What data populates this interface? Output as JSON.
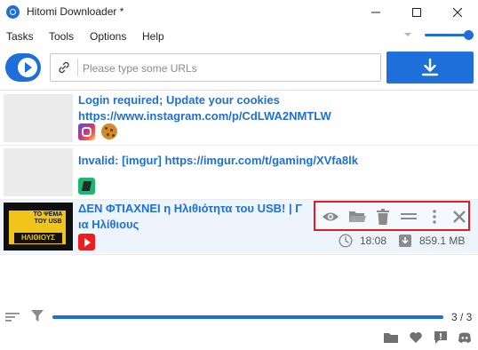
{
  "window": {
    "title": "Hitomi Downloader *"
  },
  "menu": [
    "Tasks",
    "Tools",
    "Options",
    "Help"
  ],
  "toolbar": {
    "url_placeholder": "Please type some URLs",
    "url_value": ""
  },
  "tasks": [
    {
      "title": "Login required; Update your cookies https://www.instagram.com/p/CdLWA2NMTLW",
      "site_icon": "instagram-icon",
      "extra_icon": "cookie-icon",
      "selected": false
    },
    {
      "title": "Invalid: [imgur] https://imgur.com/t/gaming/XVfa8lk",
      "site_icon": "imgur-icon",
      "selected": false
    },
    {
      "title": "ΔΕΝ ΦΤΙΑΧΝΕΙ η Ηλιθιότητα του USB! | Γ…α Ηλίθιους",
      "title_line1": "ΔΕΝ ΦΤΙΑΧΝΕΙ η Ηλιθιότητα του USB! | Γ",
      "title_line2": "ια Ηλίθιους",
      "site_icon": "youtube-icon",
      "duration": "18:08",
      "size": "859.1 MB",
      "thumb_text": "ΤΟ ΨΕΜΑ ΤΟΥ USB",
      "thumb_text2": "ΗΛΙΘΙΟΥΣ",
      "selected": true,
      "actions": [
        "view-icon",
        "folder-icon",
        "trash-icon",
        "menu-lines-icon",
        "more-vertical-icon",
        "close-icon"
      ]
    }
  ],
  "status": {
    "progress_fraction": 1.0,
    "progress_text": "3 / 3"
  },
  "colors": {
    "accent": "#1e6fd9",
    "title_link": "#1e6fd9",
    "highlight_border": "#e31b23",
    "selected_row": "#eef4fc"
  }
}
